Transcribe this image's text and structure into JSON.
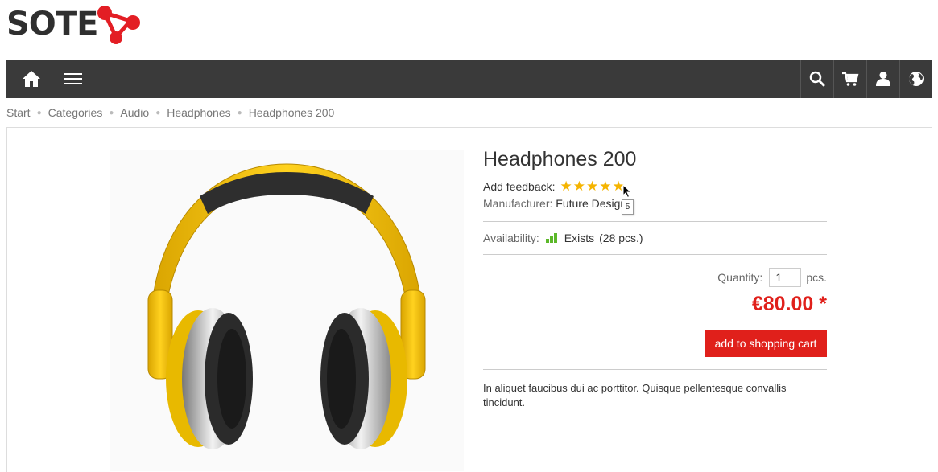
{
  "brand": {
    "name": "SOTE",
    "accent": "#e31e24"
  },
  "navbar": {
    "bg": "#3a3a3a",
    "left_icons": [
      "home-icon",
      "menu-icon"
    ],
    "right_icons": [
      "search-icon",
      "cart-icon",
      "user-icon",
      "globe-icon"
    ]
  },
  "breadcrumb": [
    "Start",
    "Categories",
    "Audio",
    "Headphones",
    "Headphones 200"
  ],
  "product": {
    "title": "Headphones 200",
    "feedback_label": "Add feedback:",
    "stars": [
      "★",
      "★",
      "★",
      "★",
      "★"
    ],
    "star_tooltip": "5",
    "manufacturer_label": "Manufacturer:",
    "manufacturer": "Future Design",
    "availability_label": "Availability:",
    "availability_status": "Exists",
    "availability_count": "(28 pcs.)",
    "quantity_label": "Quantity:",
    "quantity_value": "1",
    "quantity_unit": "pcs.",
    "price": "€80.00 *",
    "add_to_cart": "add to shopping cart",
    "description": "In aliquet faucibus dui ac porttitor. Quisque pellentesque convallis tincidunt.",
    "image_alt": "headphones-image"
  }
}
